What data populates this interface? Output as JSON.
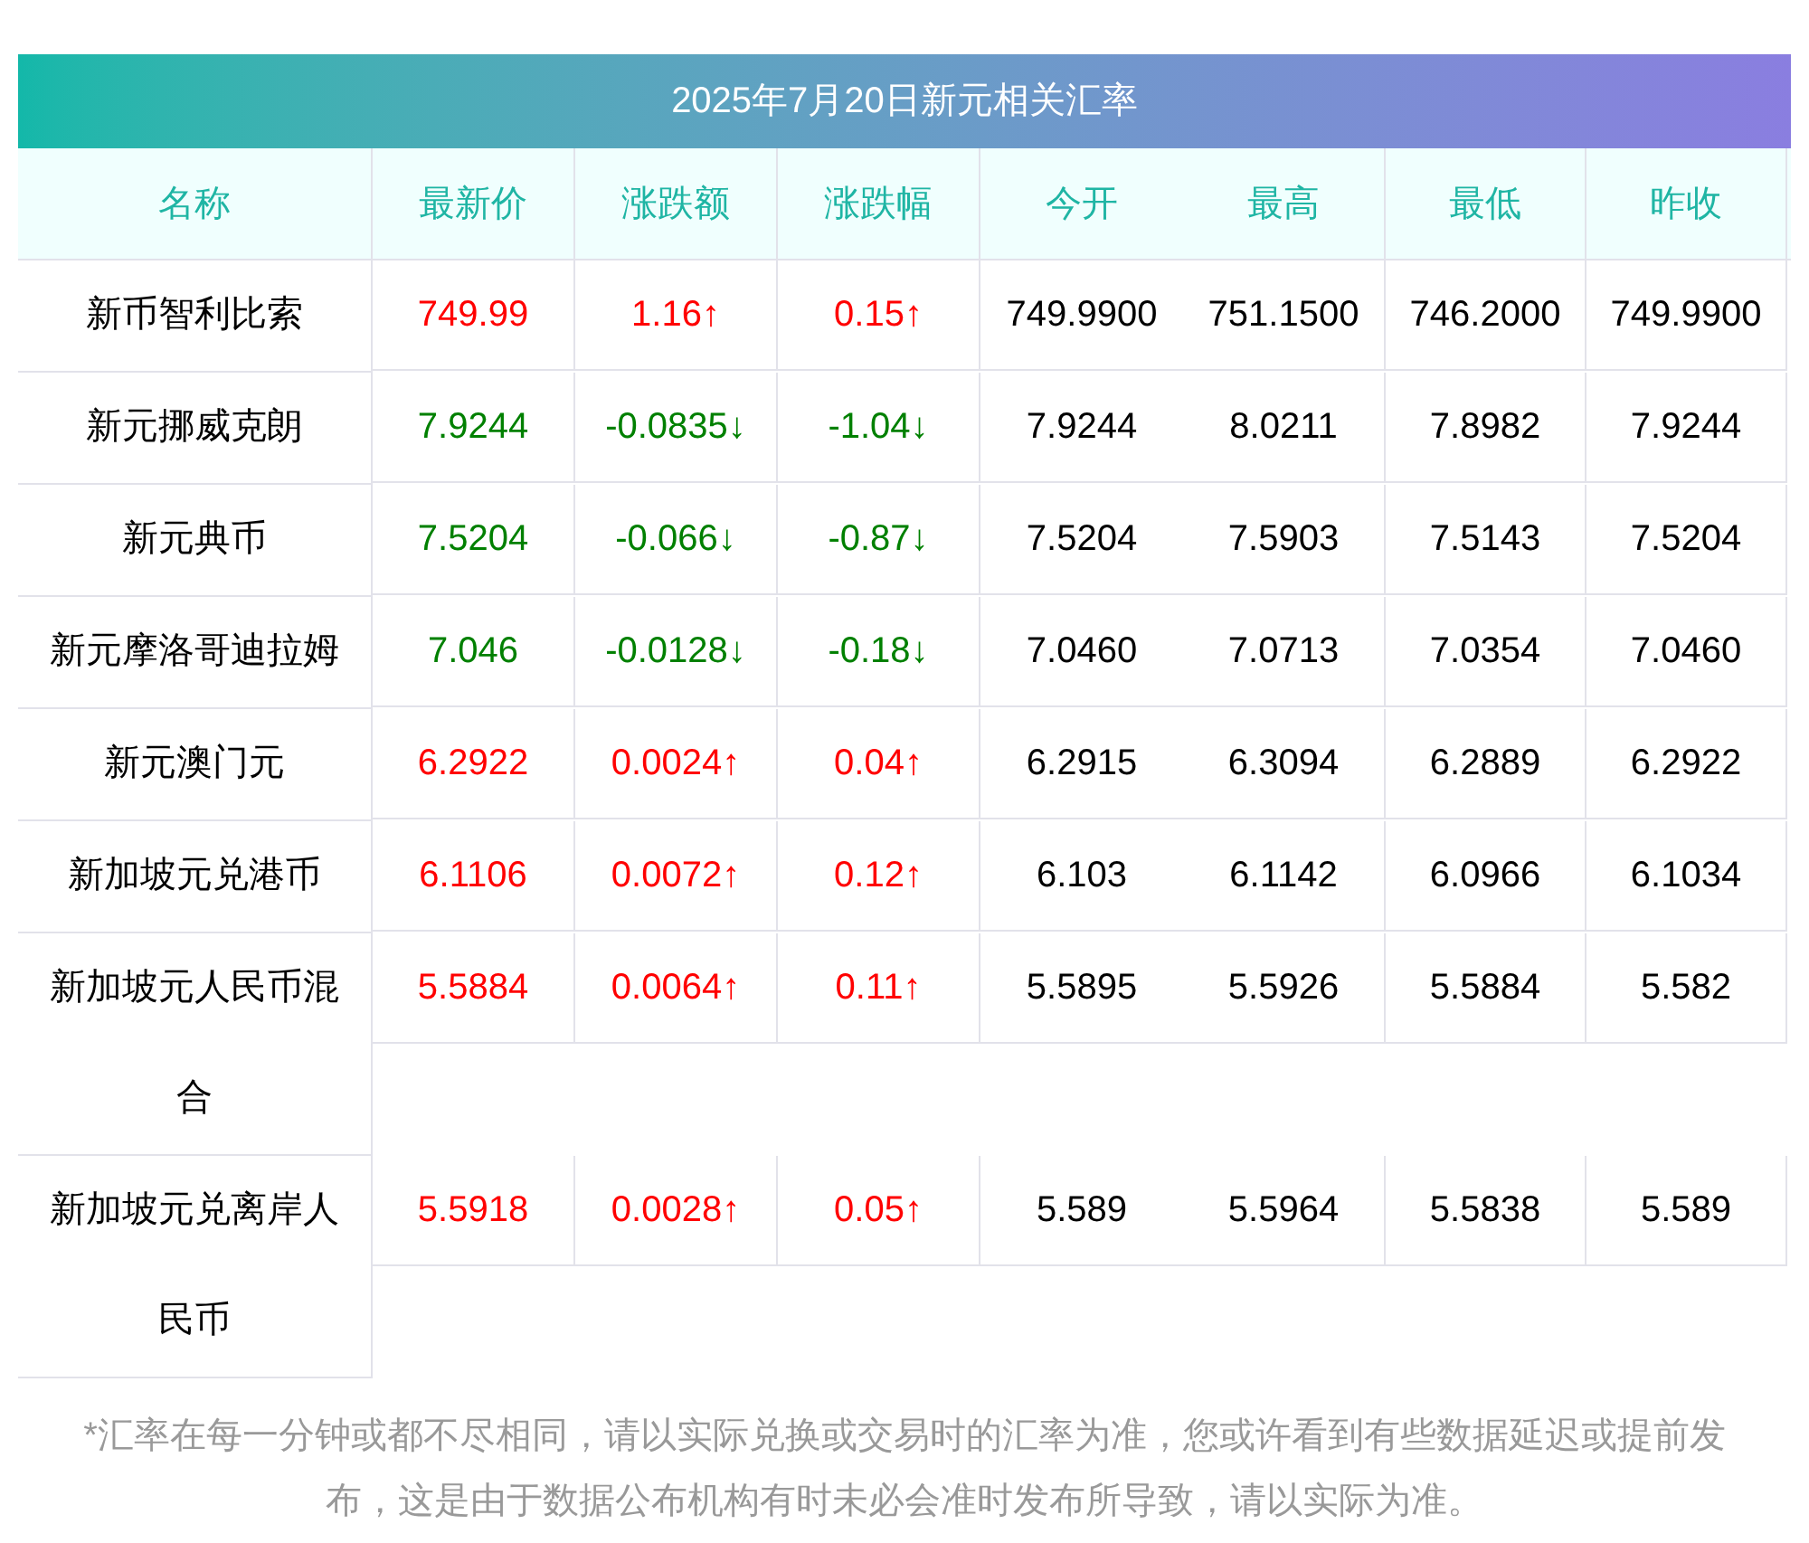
{
  "title": "2025年7月20日新元相关汇率",
  "columns": [
    "名称",
    "最新价",
    "涨跌额",
    "涨跌幅",
    "今开",
    "最高",
    "最低",
    "昨收"
  ],
  "rows": [
    {
      "name": "新币智利比索",
      "rising": true,
      "cells": [
        "749.99",
        "1.16↑",
        "0.15↑",
        "749.9900",
        "751.1500",
        "746.2000",
        "749.9900"
      ]
    },
    {
      "name": "新元挪威克朗",
      "rising": false,
      "cells": [
        "7.9244",
        "-0.0835↓",
        "-1.04↓",
        "7.9244",
        "8.0211",
        "7.8982",
        "7.9244"
      ]
    },
    {
      "name": "新元典币",
      "rising": false,
      "cells": [
        "7.5204",
        "-0.066↓",
        "-0.87↓",
        "7.5204",
        "7.5903",
        "7.5143",
        "7.5204"
      ]
    },
    {
      "name": "新元摩洛哥迪拉姆",
      "rising": false,
      "cells": [
        "7.046",
        "-0.0128↓",
        "-0.18↓",
        "7.0460",
        "7.0713",
        "7.0354",
        "7.0460"
      ]
    },
    {
      "name": "新元澳门元",
      "rising": true,
      "cells": [
        "6.2922",
        "0.0024↑",
        "0.04↑",
        "6.2915",
        "6.3094",
        "6.2889",
        "6.2922"
      ]
    },
    {
      "name": "新加坡元兑港币",
      "rising": true,
      "cells": [
        "6.1106",
        "0.0072↑",
        "0.12↑",
        "6.103",
        "6.1142",
        "6.0966",
        "6.1034"
      ]
    },
    {
      "name": "新加坡元人民币混合",
      "rising": true,
      "cells": [
        "5.5884",
        "0.0064↑",
        "0.11↑",
        "5.5895",
        "5.5926",
        "5.5884",
        "5.582"
      ]
    },
    {
      "name": "新加坡元兑离岸人民币",
      "rising": true,
      "cells": [
        "5.5918",
        "0.0028↑",
        "0.05↑",
        "5.589",
        "5.5964",
        "5.5838",
        "5.589"
      ]
    }
  ],
  "note": "*汇率在每一分钟或都不尽相同，请以实际兑换或交易时的汇率为准，您或许看到有些数据延迟或提前发布，这是由于数据公布机构有时未必会准时发布所导致，请以实际为准。"
}
